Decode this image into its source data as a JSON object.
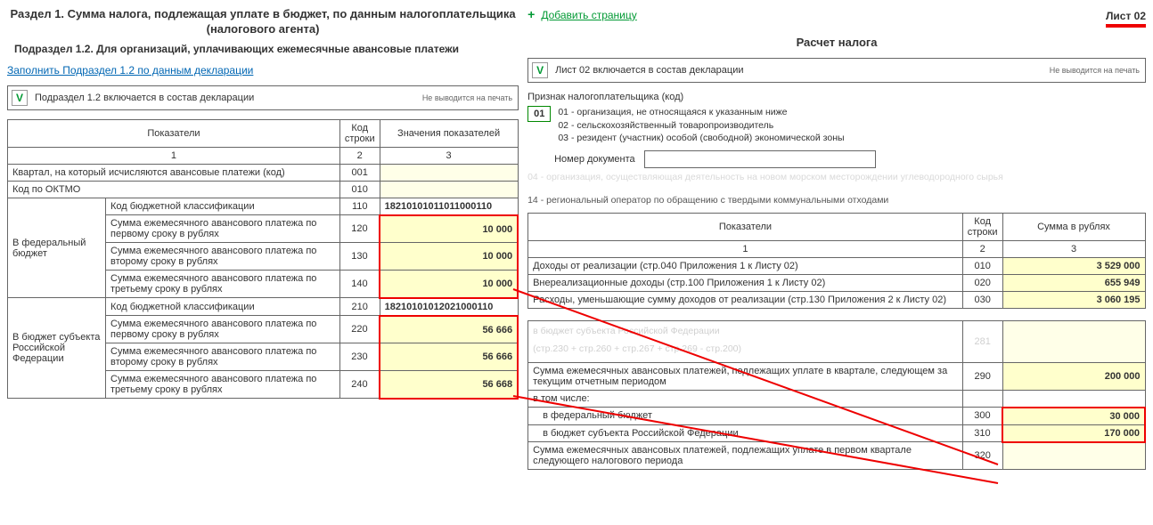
{
  "left": {
    "title": "Раздел 1. Сумма налога, подлежащая уплате в бюджет, по данным налогоплательщика (налогового агента)",
    "subtitle": "Подраздел 1.2. Для организаций, уплачивающих ежемесячные авансовые платежи",
    "fill_link": "Заполнить Подраздел 1.2 по данным декларации",
    "include_label": "Подраздел 1.2 включается в состав декларации",
    "noprint": "Не выводится на печать",
    "cols": {
      "indicators": "Показатели",
      "code": "Код строки",
      "values": "Значения показателей",
      "c1": "1",
      "c2": "2",
      "c3": "3"
    },
    "row_quarter": "Квартал, на который исчисляются авансовые платежи (код)",
    "code_001": "001",
    "row_oktmo": "Код по ОКТМО",
    "code_010": "010",
    "group_fed": "В федеральный бюджет",
    "group_subj": "В бюджет субъекта Российской Федерации",
    "rows": {
      "kbk": "Код бюджетной классификации",
      "p1": "Сумма ежемесячного авансового платежа по первому сроку в рублях",
      "p2": "Сумма ежемесячного авансового платежа по второму сроку в рублях",
      "p3": "Сумма ежемесячного авансового платежа по третьему сроку в рублях"
    },
    "fed": {
      "kbk_code": "110",
      "kbk": "18210101011011000110",
      "c120": "120",
      "v120": "10 000",
      "c130": "130",
      "v130": "10 000",
      "c140": "140",
      "v140": "10 000"
    },
    "subj": {
      "kbk_code": "210",
      "kbk": "18210101012021000110",
      "c220": "220",
      "v220": "56 666",
      "c230": "230",
      "v230": "56 666",
      "c240": "240",
      "v240": "56 668"
    }
  },
  "right": {
    "add_page": "Добавить страницу",
    "sheet": "Лист 02",
    "calc_title": "Расчет налога",
    "include_label": "Лист 02 включается в состав декларации",
    "noprint": "Не выводится на печать",
    "sign_label": "Признак налогоплательщика (код)",
    "sign_code": "01",
    "sign_opts": {
      "o1": "01 - организация, не относящаяся к указанным ниже",
      "o2": "02 - сельскохозяйственный товаропроизводитель",
      "o3": "03 - резидент (участник) особой (свободной) экономической зоны"
    },
    "doc_num_label": "Номер документа",
    "faded_line": "04 - организация, осуществляющая деятельность на новом морском месторождении углеводородного сырья",
    "note14": "14 - региональный оператор по обращению с твердыми коммунальными отходами",
    "cols": {
      "indicators": "Показатели",
      "code": "Код строки",
      "rub": "Сумма в рублях",
      "c1": "1",
      "c2": "2",
      "c3": "3"
    },
    "r010": {
      "t": "Доходы от реализации (стр.040 Приложения 1 к Листу 02)",
      "c": "010",
      "v": "3 529 000"
    },
    "r020": {
      "t": "Внереализационные доходы (стр.100 Приложения 1 к Листу 02)",
      "c": "020",
      "v": "655 949"
    },
    "r030": {
      "t": "Расходы, уменьшающие сумму доходов от реализации (стр.130 Приложения 2 к Листу 02)",
      "c": "030",
      "v": "3 060 195"
    },
    "faded_subj": "в бюджет субъекта Российской Федерации",
    "faded_formula": "(стр.230 + стр.260 + стр.267 + стр.269 - стр.200)",
    "r281c": "281",
    "r290": {
      "t": "Сумма ежемесячных авансовых платежей, подлежащих уплате в квартале, следующем за текущим отчетным периодом",
      "c": "290",
      "v": "200 000"
    },
    "incl": "в том числе:",
    "r300": {
      "t": "в федеральный бюджет",
      "c": "300",
      "v": "30 000"
    },
    "r310": {
      "t": "в бюджет субъекта Российской Федерации",
      "c": "310",
      "v": "170 000"
    },
    "r320": {
      "t": "Сумма ежемесячных авансовых платежей, подлежащих уплате в первом квартале следующего налогового периода",
      "c": "320"
    }
  }
}
